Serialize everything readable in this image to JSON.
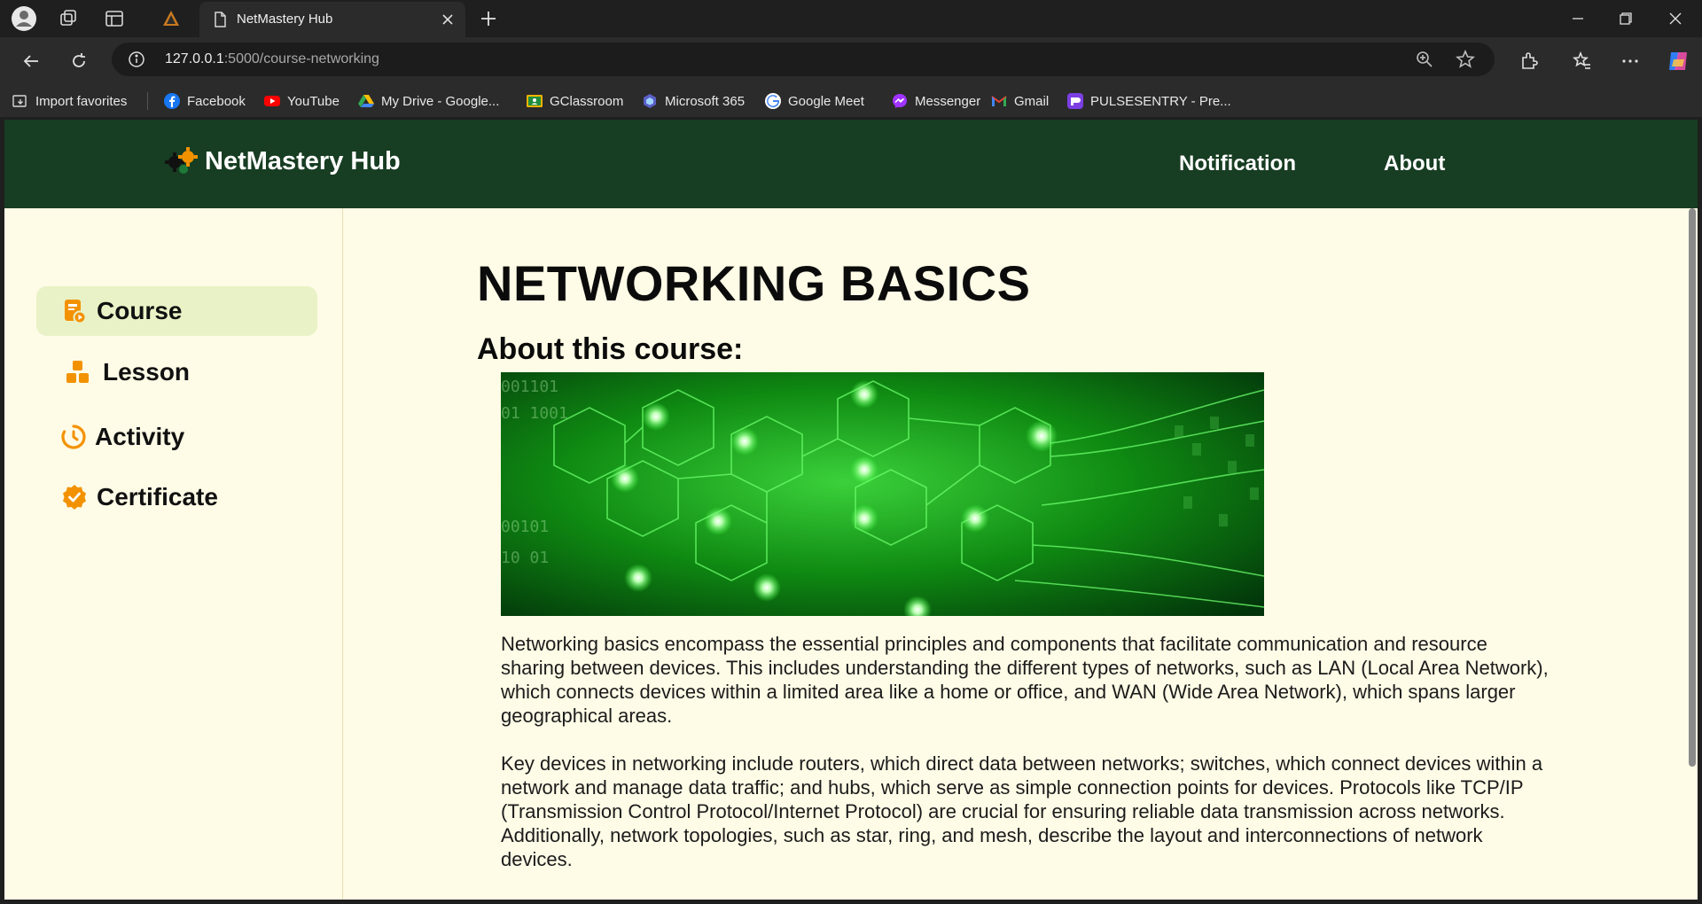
{
  "browser": {
    "tab_title": "NetMastery Hub",
    "url_host": "127.0.0.1",
    "url_path": ":5000/course-networking",
    "bookmarks": [
      {
        "label": "Import favorites",
        "icon": "import-icon"
      },
      {
        "label": "Facebook",
        "icon": "facebook-icon"
      },
      {
        "label": "YouTube",
        "icon": "youtube-icon"
      },
      {
        "label": "My Drive - Google...",
        "icon": "google-drive-icon"
      },
      {
        "label": "GClassroom",
        "icon": "classroom-icon"
      },
      {
        "label": "Microsoft 365",
        "icon": "microsoft365-icon"
      },
      {
        "label": "Google Meet",
        "icon": "google-icon"
      },
      {
        "label": "Messenger",
        "icon": "messenger-icon"
      },
      {
        "label": "Gmail",
        "icon": "gmail-icon"
      },
      {
        "label": "PULSESENTRY - Pre...",
        "icon": "pulsesentry-icon"
      }
    ]
  },
  "site": {
    "brand": "NetMastery Hub",
    "nav": {
      "notification": "Notification",
      "about": "About"
    },
    "colors": {
      "header": "#173d22",
      "page": "#fefbe6",
      "accent": "#f39200",
      "active_item": "#e9f2c6"
    }
  },
  "sidebar": {
    "items": [
      {
        "label": "Course",
        "icon": "course-icon",
        "active": true
      },
      {
        "label": "Lesson",
        "icon": "lesson-blocks-icon",
        "active": false
      },
      {
        "label": "Activity",
        "icon": "activity-icon",
        "active": false
      },
      {
        "label": "Certificate",
        "icon": "certificate-badge-icon",
        "active": false
      }
    ]
  },
  "course": {
    "title": "NETWORKING BASICS",
    "about_heading": "About this course:",
    "paragraph_1": "Networking basics encompass the essential principles and components that facilitate communication and resource sharing between devices. This includes understanding the different types of networks, such as LAN (Local Area Network), which connects devices within a limited area like a home or office, and WAN (Wide Area Network), which spans larger geographical areas.",
    "paragraph_2": "Key devices in networking include routers, which direct data between networks; switches, which connect devices within a network and manage data traffic; and hubs, which serve as simple connection points for devices. Protocols like TCP/IP (Transmission Control Protocol/Internet Protocol) are crucial for ensuring reliable data transmission across networks. Additionally, network topologies, such as star, ring, and mesh, describe the layout and interconnections of network devices."
  }
}
